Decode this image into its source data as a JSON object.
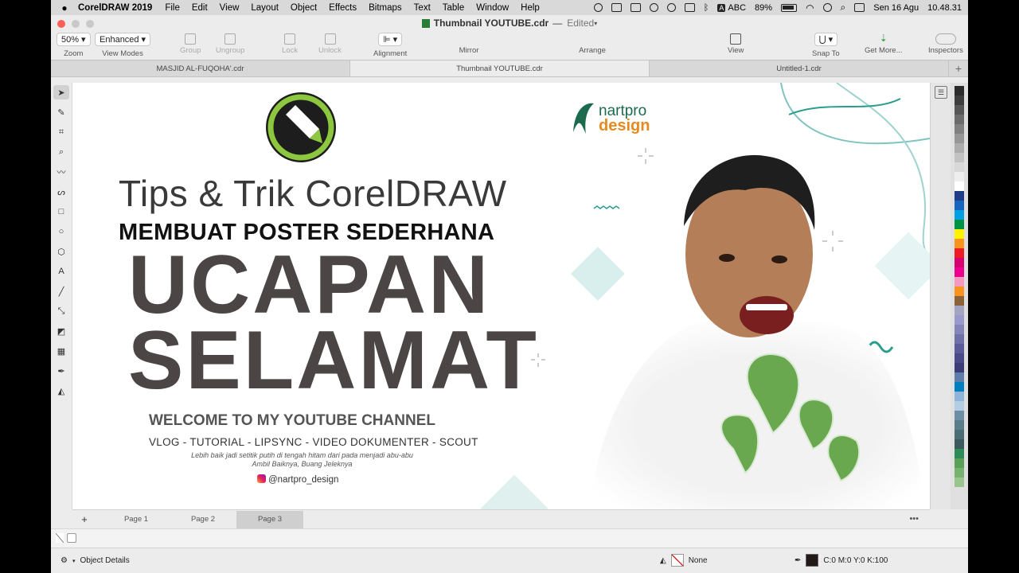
{
  "menubar": {
    "app_name": "CorelDRAW 2019",
    "items": [
      "File",
      "Edit",
      "View",
      "Layout",
      "Object",
      "Effects",
      "Bitmaps",
      "Text",
      "Table",
      "Window",
      "Help"
    ],
    "input_source": "ABC",
    "battery": "89%",
    "date": "Sen 16 Agu",
    "time": "10.48.31"
  },
  "titlebar": {
    "document": "Thumbnail YOUTUBE.cdr",
    "separator": "—",
    "status": "Edited"
  },
  "toolbar": {
    "zoom_value": "50%",
    "zoom_label": "Zoom",
    "view_mode_value": "Enhanced",
    "view_mode_label": "View Modes",
    "group_label": "Group",
    "ungroup_label": "Ungroup",
    "lock_label": "Lock",
    "unlock_label": "Unlock",
    "alignment_label": "Alignment",
    "mirror_label": "Mirror",
    "arrange_label": "Arrange",
    "view_label": "View",
    "snap_label": "Snap To",
    "getmore_label": "Get More...",
    "inspectors_label": "Inspectors"
  },
  "doc_tabs": [
    "MASJID AL-FUQOHA'.cdr",
    "Thumbnail YOUTUBE.cdr",
    "Untitled-1.cdr"
  ],
  "poster": {
    "title": "Tips & Trik CorelDRAW",
    "subtitle": "MEMBUAT POSTER SEDERHANA",
    "headline_1": "UCAPAN",
    "headline_2": "SELAMAT",
    "welcome": "WELCOME TO MY YOUTUBE CHANNEL",
    "categories": "VLOG - TUTORIAL - LIPSYNC - VIDEO DOKUMENTER - SCOUT",
    "quote_1": "Lebih baik jadi setitik putih di tengah hitam dari pada menjadi abu-abu",
    "quote_2": "Ambil Baiknya, Buang Jeleknya",
    "instagram": "@nartpro_design",
    "logo_top": "nartpro",
    "logo_bottom": "design"
  },
  "page_tabs": [
    "Page 1",
    "Page 2",
    "Page 3"
  ],
  "status": {
    "object_details": "Object Details",
    "fill": "None",
    "outline": "C:0 M:0 Y:0 K:100"
  },
  "palette_colors": [
    "#2b2b2b",
    "#3d3d3d",
    "#555555",
    "#6b6b6b",
    "#808080",
    "#969696",
    "#acacac",
    "#c2c2c2",
    "#d8d8d8",
    "#eeeeee",
    "#ffffff",
    "#1f3c88",
    "#1565c0",
    "#00a0e3",
    "#009245",
    "#fff200",
    "#f7941d",
    "#ed1c24",
    "#d6006f",
    "#ec008c",
    "#f49ac1",
    "#f7931e",
    "#8c6239",
    "#a3a3c2",
    "#9999cc",
    "#8585b8",
    "#7070a8",
    "#5b5b99",
    "#4a4a88",
    "#3c3c78",
    "#5c7ea8",
    "#007fc0",
    "#8fb4d9",
    "#b3cde3",
    "#6d8fa6",
    "#5a7d8c",
    "#4b6b75",
    "#3c5960",
    "#2e8b57",
    "#5aa05a",
    "#77b36e",
    "#9bc58f"
  ]
}
